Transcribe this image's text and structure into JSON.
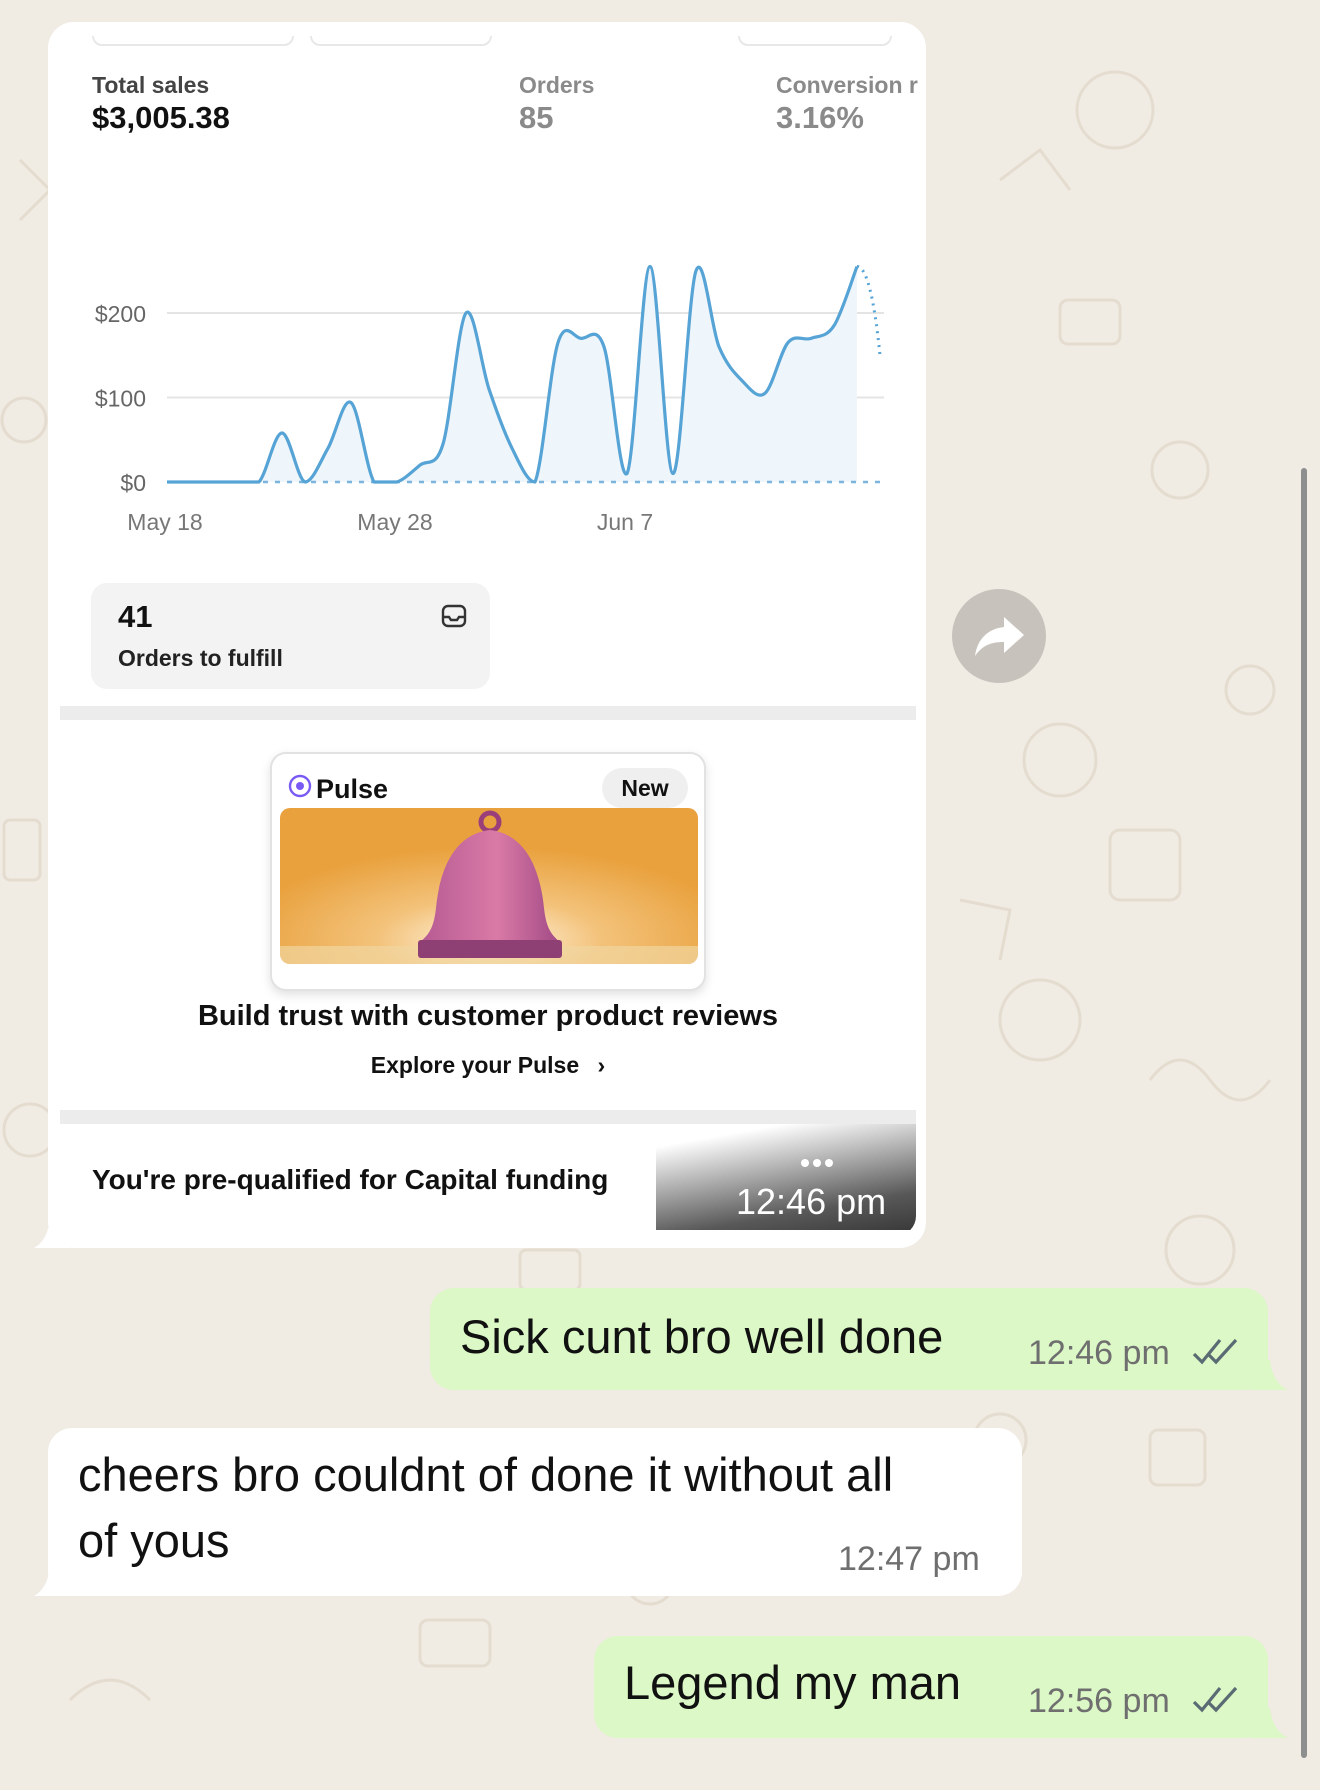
{
  "screenshot": {
    "metrics": [
      {
        "label": "Total sales",
        "value": "$3,005.38"
      },
      {
        "label": "Orders",
        "value": "85"
      },
      {
        "label": "Conversion r",
        "value": "3.16%"
      }
    ],
    "orders_to_fulfill": {
      "count": "41",
      "label": "Orders to fulfill"
    },
    "pulse": {
      "title": "Pulse",
      "badge": "New",
      "headline": "Build trust with customer product reviews",
      "link": "Explore your Pulse",
      "link_chevron": "›"
    },
    "capital_banner": "You're pre-qualified for Capital funding",
    "more_icon": "ellipsis-icon",
    "timestamp": "12:46 pm"
  },
  "chart_data": {
    "type": "line",
    "x_tick_labels": [
      "May 18",
      "May 28",
      "Jun 7"
    ],
    "y_tick_labels": [
      "$200",
      "$100",
      "$0"
    ],
    "ylim": [
      0,
      260
    ],
    "grid": true,
    "series": [
      {
        "style": "solid",
        "x": [
          0,
          1,
          2,
          3,
          4,
          5,
          6,
          7,
          8,
          9,
          10,
          11,
          12,
          13,
          14,
          15,
          16,
          17,
          18,
          19,
          20,
          21,
          22,
          23,
          24,
          25,
          26,
          27,
          28,
          29,
          30
        ],
        "values": [
          0,
          0,
          0,
          0,
          0,
          58,
          0,
          40,
          94,
          0,
          0,
          20,
          45,
          200,
          110,
          40,
          0,
          165,
          170,
          160,
          10,
          255,
          10,
          250,
          160,
          120,
          105,
          165,
          170,
          185,
          255
        ]
      },
      {
        "style": "dotted",
        "x": [
          30,
          31
        ],
        "values": [
          255,
          150
        ]
      },
      {
        "style": "dashed-baseline",
        "x": [
          0,
          31
        ],
        "values": [
          0,
          0
        ]
      }
    ],
    "colors": {
      "line": "#56a3d6",
      "fill": "#eef5fb",
      "grid": "#e4e4e4",
      "baseline": "#7bb4dd"
    }
  },
  "messages": [
    {
      "direction": "outgoing",
      "text": "Sick cunt bro well done",
      "time": "12:46 pm",
      "status": "read-ticks-icon"
    },
    {
      "direction": "incoming",
      "lines": [
        "cheers bro couldnt of done it without all",
        "of yous"
      ],
      "time": "12:47 pm"
    },
    {
      "direction": "outgoing",
      "text": "Legend my man",
      "time": "12:56 pm",
      "status": "read-ticks-icon"
    }
  ],
  "icons": {
    "forward": "forward-arrow-icon",
    "inbox": "inbox-icon",
    "pulse": "pulse-target-icon"
  },
  "colors": {
    "wallpaper": "#f0ebe3",
    "outgoing_bubble": "#dbf8c6",
    "incoming_bubble": "#ffffff",
    "accent_purple": "#7a5af5"
  }
}
